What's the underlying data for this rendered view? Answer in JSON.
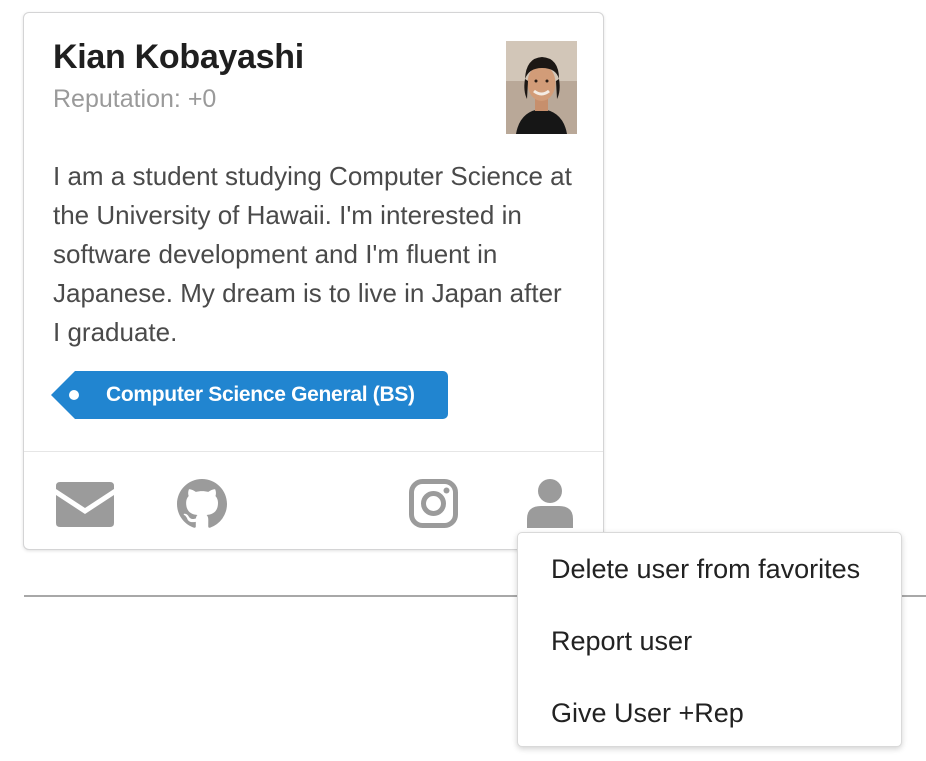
{
  "profile": {
    "name": "Kian Kobayashi",
    "reputation": "Reputation: +0",
    "bio": "I am a student studying Computer Science at the University of Hawaii. I'm interested in software development and I'm fluent in Japanese. My dream is to live in Japan after I graduate.",
    "major_tag": "Computer Science General (BS)"
  },
  "contact_icons": [
    "envelope-icon",
    "github-icon",
    "instagram-icon",
    "user-icon"
  ],
  "context_menu": {
    "items": [
      "Delete user from favorites",
      "Report user",
      "Give User +Rep"
    ]
  },
  "colors": {
    "tag_blue": "#2185d0",
    "icon_gray": "#9b9b9b"
  }
}
